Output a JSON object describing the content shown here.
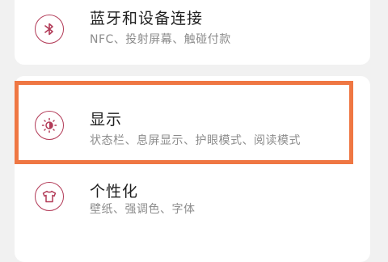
{
  "settings": {
    "items": [
      {
        "title": "蓝牙和设备连接",
        "subtitle": "NFC、投射屏幕、触碰付款",
        "icon": "bluetooth-icon"
      },
      {
        "title": "显示",
        "subtitle": "状态栏、息屏显示、护眼模式、阅读模式",
        "icon": "brightness-icon"
      },
      {
        "title": "个性化",
        "subtitle": "壁纸、强调色、字体",
        "icon": "tshirt-icon"
      }
    ]
  },
  "colors": {
    "accent": "#b23a57",
    "highlight": "#ef7743",
    "background": "#f1f1f1",
    "card": "#ffffff"
  }
}
